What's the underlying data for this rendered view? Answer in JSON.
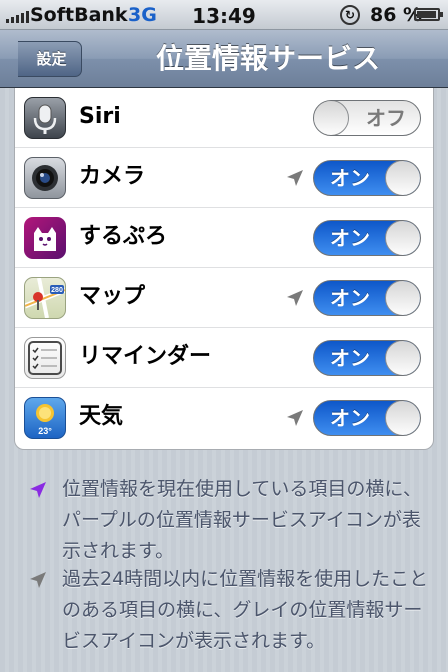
{
  "status_bar": {
    "carrier": "SoftBank",
    "network": "3G",
    "time": "13:49",
    "battery_percent": "86 %",
    "battery_level": 0.86
  },
  "nav": {
    "back_label": "設定",
    "title": "位置情報サービス"
  },
  "rows": [
    {
      "label": "Siri",
      "switch_label": "オフ",
      "state": "off",
      "location_arrow": "none",
      "icon": "siri-icon"
    },
    {
      "label": "カメラ",
      "switch_label": "オン",
      "state": "on",
      "location_arrow": "gray",
      "icon": "camera-icon"
    },
    {
      "label": "するぷろ",
      "switch_label": "オン",
      "state": "on",
      "location_arrow": "none",
      "icon": "surupuro-icon"
    },
    {
      "label": "マップ",
      "switch_label": "オン",
      "state": "on",
      "location_arrow": "gray",
      "icon": "maps-icon",
      "icon_badge": "280"
    },
    {
      "label": "リマインダー",
      "switch_label": "オン",
      "state": "on",
      "location_arrow": "none",
      "icon": "reminders-icon"
    },
    {
      "label": "天気",
      "switch_label": "オン",
      "state": "on",
      "location_arrow": "gray",
      "icon": "weather-icon",
      "icon_badge": "23°"
    }
  ],
  "notes": [
    {
      "text": "位置情報を現在使用している項目の横に、パープルの位置情報サービスアイコンが表示されます。",
      "arrow": "purple-location-arrow-icon"
    },
    {
      "text": "過去24時間以内に位置情報を使用したことのある項目の横に、グレイの位置情報サービスアイコンが表示されます。",
      "arrow": "gray-location-arrow-icon"
    }
  ],
  "colors": {
    "purple_arrow": "#8a2be2",
    "gray_arrow": "#7a7a7a",
    "switch_on": "#1f6fe0",
    "nav_bar": "#7d90ab"
  }
}
